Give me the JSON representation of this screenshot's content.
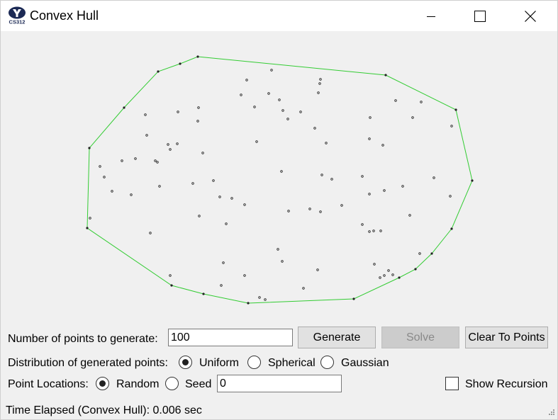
{
  "window": {
    "title": "Convex Hull",
    "icon": "byu-cs312-logo",
    "icon_caption": "CS312"
  },
  "titlebar_buttons": {
    "minimize": "minimize-icon",
    "maximize": "maximize-icon",
    "close": "close-icon"
  },
  "canvas": {
    "hull_color": "#33cc33",
    "point_color": "#222222"
  },
  "controls": {
    "num_points_label": "Number of points to generate:",
    "num_points_value": "100",
    "generate_label": "Generate",
    "solve_label": "Solve",
    "clear_label": "Clear To Points",
    "distribution_label": "Distribution of generated points:",
    "distribution_options": [
      "Uniform",
      "Spherical",
      "Gaussian"
    ],
    "distribution_selected": "Uniform",
    "locations_label": "Point Locations:",
    "location_options": [
      "Random",
      "Seed"
    ],
    "location_selected": "Random",
    "seed_value": "0",
    "show_recursion_label": "Show Recursion",
    "show_recursion_checked": false
  },
  "status": {
    "text": "Time Elapsed (Convex Hull): 0.006 sec"
  }
}
